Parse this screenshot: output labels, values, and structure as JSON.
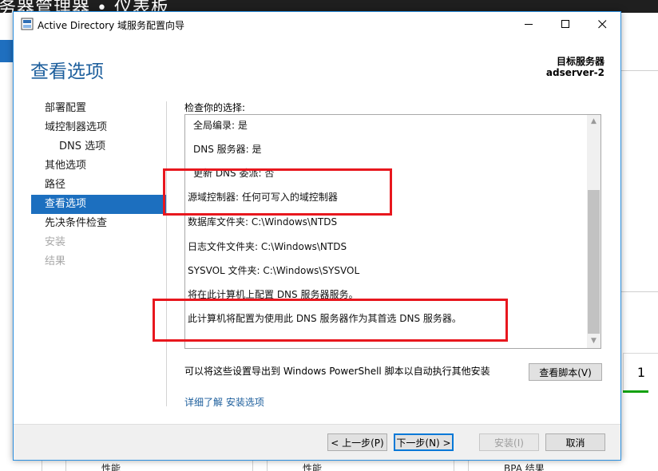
{
  "background": {
    "title": "务器管理器 • 仪表板",
    "tile_number": "1",
    "bottom_labels": [
      "性能",
      "性能",
      "BPA 结果"
    ]
  },
  "dialog": {
    "title": "Active Directory 域服务配置向导",
    "window_controls": {
      "minimize": "—",
      "maximize": "☐",
      "close": "✕"
    },
    "page_title": "查看选项",
    "target_server_label": "目标服务器",
    "target_server_value": "adserver-2",
    "nav": [
      {
        "label": "部署配置",
        "state": "normal"
      },
      {
        "label": "域控制器选项",
        "state": "normal"
      },
      {
        "label": "DNS 选项",
        "state": "sub"
      },
      {
        "label": "其他选项",
        "state": "normal"
      },
      {
        "label": "路径",
        "state": "normal"
      },
      {
        "label": "查看选项",
        "state": "active"
      },
      {
        "label": "先决条件检查",
        "state": "normal"
      },
      {
        "label": "安装",
        "state": "disabled"
      },
      {
        "label": "结果",
        "state": "disabled"
      }
    ],
    "review_label": "检查你的选择:",
    "review_lines": [
      "全局编录: 是",
      "DNS 服务器: 是",
      "更新 DNS 委派: 否",
      "源域控制器: 任何可写入的域控制器",
      "数据库文件夹: C:\\Windows\\NTDS",
      "日志文件文件夹: C:\\Windows\\NTDS",
      "SYSVOL 文件夹: C:\\Windows\\SYSVOL",
      "将在此计算机上配置 DNS 服务器服务。",
      "此计算机将配置为使用此 DNS 服务器作为其首选 DNS 服务器。"
    ],
    "export_text": "可以将这些设置导出到 Windows PowerShell 脚本以自动执行其他安装",
    "view_script_button": "查看脚本(V)",
    "more_info_link": "详细了解 安装选项",
    "buttons": {
      "previous": "< 上一步(P)",
      "next": "下一步(N) >",
      "install": "安装(I)",
      "cancel": "取消"
    },
    "colors": {
      "accent": "#1c6fbf",
      "page_title": "#1c5e9c",
      "highlight_box": "#e8171e"
    }
  }
}
